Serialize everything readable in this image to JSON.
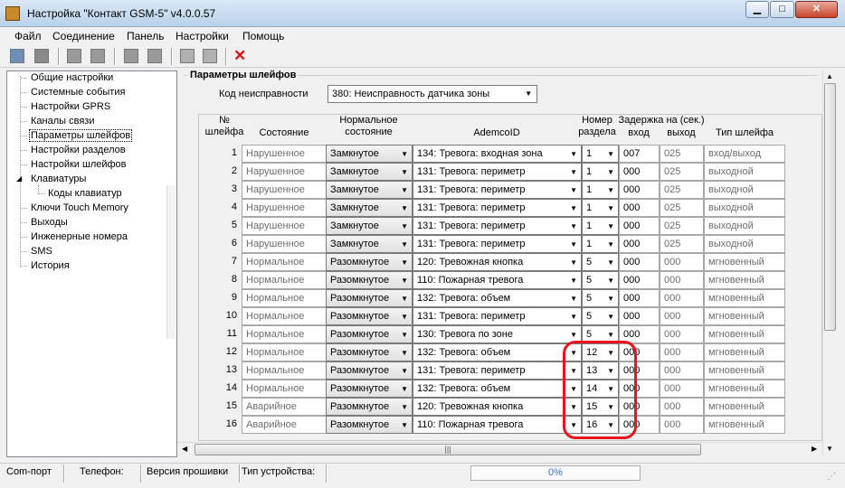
{
  "window": {
    "title": "Настройка \"Контакт GSM-5\" v4.0.0.57",
    "min": "▁",
    "max": "□",
    "close": "✕"
  },
  "menu": [
    "Файл",
    "Соединение",
    "Панель",
    "Настройки",
    "Помощь"
  ],
  "tree": {
    "items": [
      "Общие настройки",
      "Системные события",
      "Настройки GPRS",
      "Каналы связи",
      "Параметры шлейфов",
      "Настройки разделов",
      "Настройки шлейфов",
      "Клавиатуры",
      "Коды клавиатур",
      "Ключи Touch Memory",
      "Выходы",
      "Инженерные номера",
      "SMS",
      "История"
    ],
    "selected": 4
  },
  "panel": {
    "group_title": "Параметры шлейфов",
    "fault_label": "Код неисправности",
    "fault_value": "380: Неисправность датчика зоны"
  },
  "headers": {
    "num": "№\nшлейфа",
    "state": "Состояние",
    "normal": "Нормальное\nсостояние",
    "ademco": "AdemcoID",
    "partition": "Номер\nраздела",
    "delay_title": "Задержка на (сек.)",
    "delay_in": "вход",
    "delay_out": "выход",
    "type": "Тип шлейфа"
  },
  "rows": [
    {
      "n": "1",
      "state": "Нарушенное",
      "normal": "Замкнутое",
      "ademco": "134: Тревога: входная зона",
      "part": "1",
      "in": "007",
      "out": "025",
      "type": "вход/выход"
    },
    {
      "n": "2",
      "state": "Нарушенное",
      "normal": "Замкнутое",
      "ademco": "131: Тревога: периметр",
      "part": "1",
      "in": "000",
      "out": "025",
      "type": "выходной"
    },
    {
      "n": "3",
      "state": "Нарушенное",
      "normal": "Замкнутое",
      "ademco": "131: Тревога: периметр",
      "part": "1",
      "in": "000",
      "out": "025",
      "type": "выходной"
    },
    {
      "n": "4",
      "state": "Нарушенное",
      "normal": "Замкнутое",
      "ademco": "131: Тревога: периметр",
      "part": "1",
      "in": "000",
      "out": "025",
      "type": "выходной"
    },
    {
      "n": "5",
      "state": "Нарушенное",
      "normal": "Замкнутое",
      "ademco": "131: Тревога: периметр",
      "part": "1",
      "in": "000",
      "out": "025",
      "type": "выходной"
    },
    {
      "n": "6",
      "state": "Нарушенное",
      "normal": "Замкнутое",
      "ademco": "131: Тревога: периметр",
      "part": "1",
      "in": "000",
      "out": "025",
      "type": "выходной"
    },
    {
      "n": "7",
      "state": "Нормальное",
      "normal": "Разомкнутое",
      "ademco": "120: Тревожная кнопка",
      "part": "5",
      "in": "000",
      "out": "000",
      "type": "мгновенный"
    },
    {
      "n": "8",
      "state": "Нормальное",
      "normal": "Разомкнутое",
      "ademco": "110: Пожарная тревога",
      "part": "5",
      "in": "000",
      "out": "000",
      "type": "мгновенный"
    },
    {
      "n": "9",
      "state": "Нормальное",
      "normal": "Разомкнутое",
      "ademco": "132: Тревога: объем",
      "part": "5",
      "in": "000",
      "out": "000",
      "type": "мгновенный"
    },
    {
      "n": "10",
      "state": "Нормальное",
      "normal": "Разомкнутое",
      "ademco": "131: Тревога: периметр",
      "part": "5",
      "in": "000",
      "out": "000",
      "type": "мгновенный"
    },
    {
      "n": "11",
      "state": "Нормальное",
      "normal": "Разомкнутое",
      "ademco": "130: Тревога по зоне",
      "part": "5",
      "in": "000",
      "out": "000",
      "type": "мгновенный"
    },
    {
      "n": "12",
      "state": "Нормальное",
      "normal": "Разомкнутое",
      "ademco": "132: Тревога: объем",
      "part": "12",
      "in": "000",
      "out": "000",
      "type": "мгновенный"
    },
    {
      "n": "13",
      "state": "Нормальное",
      "normal": "Разомкнутое",
      "ademco": "131: Тревога: периметр",
      "part": "13",
      "in": "000",
      "out": "000",
      "type": "мгновенный"
    },
    {
      "n": "14",
      "state": "Нормальное",
      "normal": "Разомкнутое",
      "ademco": "132: Тревога: объем",
      "part": "14",
      "in": "000",
      "out": "000",
      "type": "мгновенный"
    },
    {
      "n": "15",
      "state": "Аварийное",
      "normal": "Разомкнутое",
      "ademco": "120: Тревожная кнопка",
      "part": "15",
      "in": "000",
      "out": "000",
      "type": "мгновенный"
    },
    {
      "n": "16",
      "state": "Аварийное",
      "normal": "Разомкнутое",
      "ademco": "110: Пожарная тревога",
      "part": "16",
      "in": "000",
      "out": "000",
      "type": "мгновенный"
    }
  ],
  "status": {
    "com": "Com-порт",
    "phone": "Телефон:",
    "firmware": "Версия прошивки",
    "device": "Тип устройства:",
    "progress": "0%"
  },
  "colors": {
    "annotation": "#e8141e",
    "accent": "#3a6fd0"
  },
  "icons": [
    "app-icon",
    "printer-icon",
    "connect-icon",
    "read-icon",
    "write-icon",
    "open-icon",
    "save-icon",
    "export-icon",
    "import-icon",
    "delete-icon"
  ]
}
